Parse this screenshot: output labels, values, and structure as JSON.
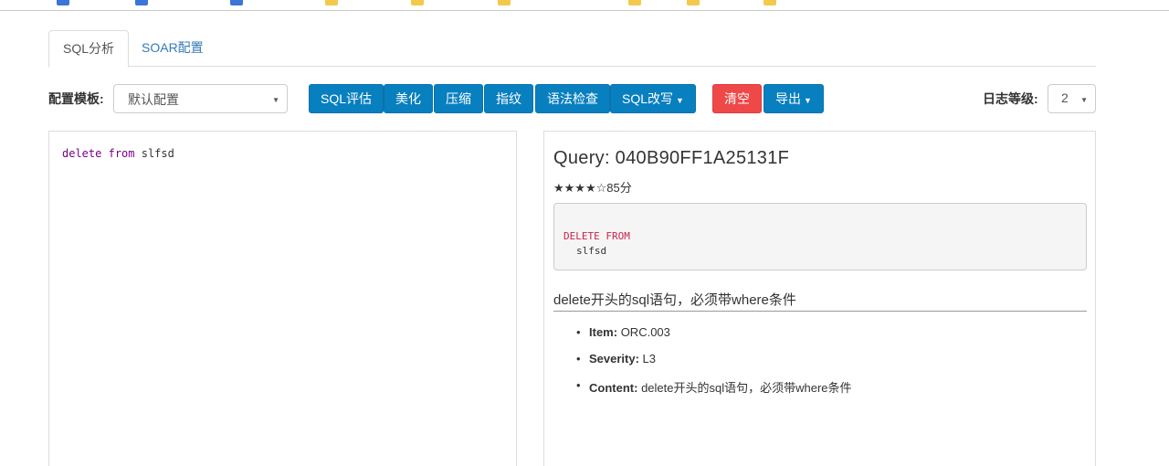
{
  "tabs": [
    {
      "label": "SQL分析",
      "active": true
    },
    {
      "label": "SOAR配置",
      "active": false
    }
  ],
  "toolbar": {
    "template_label": "配置模板:",
    "template_value": "默认配置",
    "buttons": {
      "evaluate": "SQL评估",
      "beautify": "美化",
      "compress": "压缩",
      "fingerprint": "指纹",
      "syntax_check": "语法检查",
      "rewrite": "SQL改写",
      "clear": "清空",
      "export": "导出"
    },
    "log_level_label": "日志等级:",
    "log_level_value": "2"
  },
  "editor": {
    "keyword1": "delete",
    "keyword2": "from",
    "table": "slfsd"
  },
  "result": {
    "query_title": "Query: 040B90FF1A25131F",
    "stars": "★★★★☆",
    "score": "85分",
    "formatted_keyword": "DELETE FROM",
    "formatted_table": "slfsd",
    "heading": "delete开头的sql语句，必须带where条件",
    "items": [
      {
        "key": "Item:",
        "value": "ORC.003"
      },
      {
        "key": "Severity:",
        "value": "L3"
      },
      {
        "key": "Content:",
        "value": "delete开头的sql语句，必须带where条件"
      }
    ]
  },
  "colors": {
    "primary": "#087fbf",
    "danger": "#ef4848",
    "link": "#337ab7",
    "keyword": "#770088",
    "code_keyword": "#c7254e"
  }
}
